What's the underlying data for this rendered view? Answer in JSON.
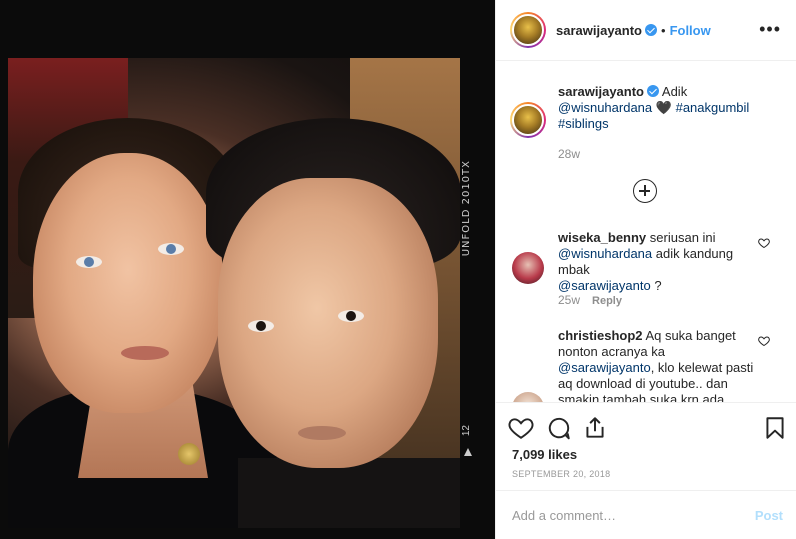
{
  "post": {
    "film_brand": "UNFOLD 2010TX",
    "film_frame_number": "12"
  },
  "header": {
    "username": "sarawijayanto",
    "separator": "•",
    "follow_label": "Follow",
    "more_label": "•••"
  },
  "caption": {
    "username": "sarawijayanto",
    "text_before": "Adik",
    "mention": "@wisnuhardana",
    "emoji": "🖤",
    "hashtag1": "#anakgumbil",
    "hashtag2": "#siblings",
    "time": "28w"
  },
  "comments": [
    {
      "username": "wiseka_benny",
      "text1": "seriusan ini",
      "mention1": "@wisnuhardana",
      "text2": "adik kandung mbak",
      "mention2": "@sarawijayanto",
      "text3": "?",
      "time": "25w",
      "reply_label": "Reply"
    },
    {
      "username": "christieshop2",
      "text1": "Aq suka banget nonton acranya ka",
      "mention1": "@sarawijayanto",
      "text2": ", klo kelewat pasti aq download di youtube.. dan smakin tambah suka krn ada"
    }
  ],
  "actions": {
    "likes": "7,099 likes",
    "date": "September 20, 2018"
  },
  "add_comment": {
    "placeholder": "Add a comment…",
    "post_label": "Post"
  },
  "icons": {
    "header_avatar": "avatar",
    "verified": "verified-badge-icon",
    "like": "heart-icon",
    "comment": "comment-icon",
    "share": "share-icon",
    "save": "bookmark-icon",
    "load_more": "plus-circle-icon"
  },
  "colors": {
    "link": "#003569",
    "follow": "#3897f0",
    "post_disabled": "#b2dffc",
    "muted": "#8e8e8e"
  }
}
